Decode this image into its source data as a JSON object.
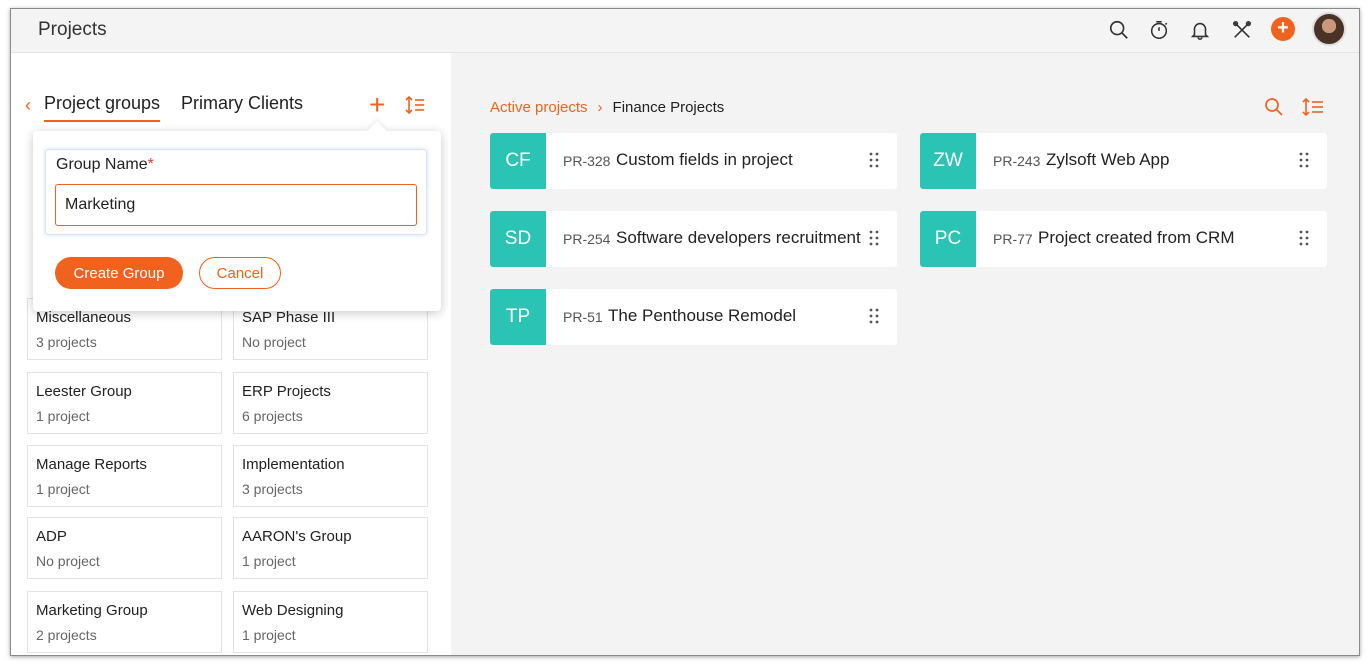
{
  "app": {
    "title": "Projects"
  },
  "topbar": {
    "icons": [
      "search-icon",
      "timer-icon",
      "bell-icon",
      "tools-icon",
      "plus-icon",
      "avatar"
    ],
    "plus_label": "+",
    "accent": "#f2621f"
  },
  "left": {
    "back": "‹",
    "tabs": [
      "Project groups",
      "Primary Clients"
    ],
    "add": "+",
    "groups": [
      {
        "name": "Miscellaneous",
        "count": "3 projects"
      },
      {
        "name": "SAP Phase III",
        "count": "No project"
      },
      {
        "name": "Leester Group",
        "count": "1 project"
      },
      {
        "name": "ERP Projects",
        "count": "6 projects"
      },
      {
        "name": "Manage Reports",
        "count": "1 project"
      },
      {
        "name": "Implementation",
        "count": "3 projects"
      },
      {
        "name": "ADP",
        "count": "No project"
      },
      {
        "name": "AARON's Group",
        "count": "1 project"
      },
      {
        "name": "Marketing Group",
        "count": "2 projects"
      },
      {
        "name": "Web Designing",
        "count": "1 project"
      }
    ]
  },
  "popup": {
    "label": "Group Name",
    "required": "*",
    "value": "Marketing",
    "create": "Create Group",
    "cancel": "Cancel"
  },
  "right": {
    "breadcrumb": {
      "link": "Active projects",
      "sep": "›",
      "current": "Finance Projects"
    },
    "projects": [
      {
        "badge": "CF",
        "code": "PR-328",
        "title": "Custom fields in project"
      },
      {
        "badge": "ZW",
        "code": "PR-243",
        "title": "Zylsoft Web App"
      },
      {
        "badge": "SD",
        "code": "PR-254",
        "title": "Software developers recruitment"
      },
      {
        "badge": "PC",
        "code": "PR-77",
        "title": "Project created from CRM"
      },
      {
        "badge": "TP",
        "code": "PR-51",
        "title": "The Penthouse Remodel"
      }
    ],
    "badge_color": "#2bc4b4"
  }
}
